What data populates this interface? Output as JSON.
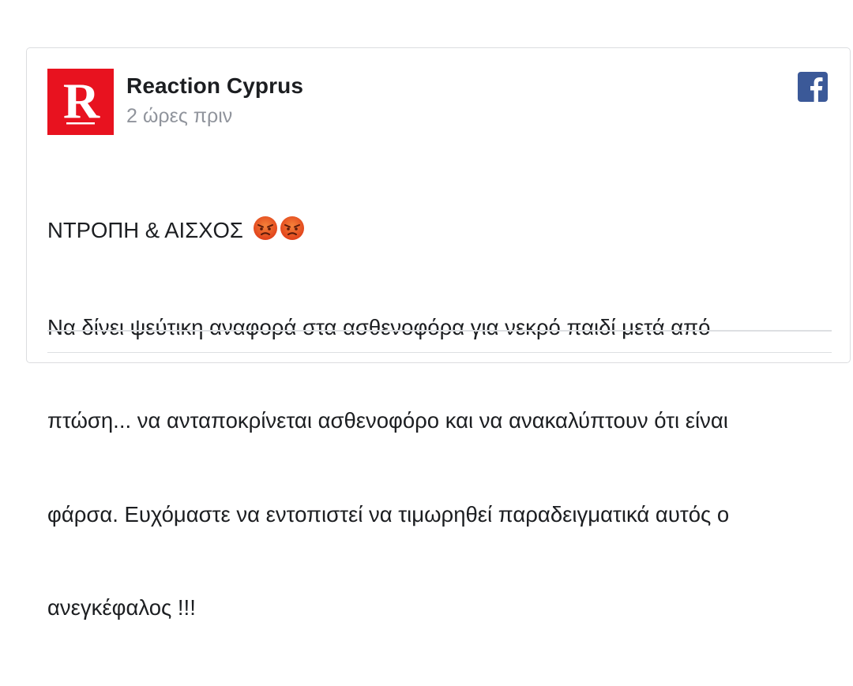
{
  "post": {
    "page_name": "Reaction Cyprus",
    "timestamp": "2 ώρες πριν",
    "avatar_letter": "R",
    "headline": "ΝΤΡΟΠΗ & ΑΙΣΧΟΣ ",
    "headline_emojis": [
      "angry-face-emoji",
      "angry-face-emoji"
    ],
    "body_lines": [
      "Να δίνει ψεύτικη αναφορά στα ασθενοφόρα για νεκρό παιδί μετά από",
      "πτώση... να ανταποκρίνεται ασθενοφόρο και να ανακαλύπτουν ότι είναι",
      "φάρσα. Ευχόμαστε να εντοπιστεί να τιμωρηθεί παραδειγματικά αυτός ο",
      "ανεγκέφαλος !!!"
    ]
  },
  "icons": {
    "social": "facebook-icon"
  },
  "colors": {
    "brand_red": "#e8121f",
    "facebook_blue": "#3b5998",
    "text": "#1c1e21",
    "muted": "#90949c",
    "emoji_orange": "#e8521a"
  }
}
